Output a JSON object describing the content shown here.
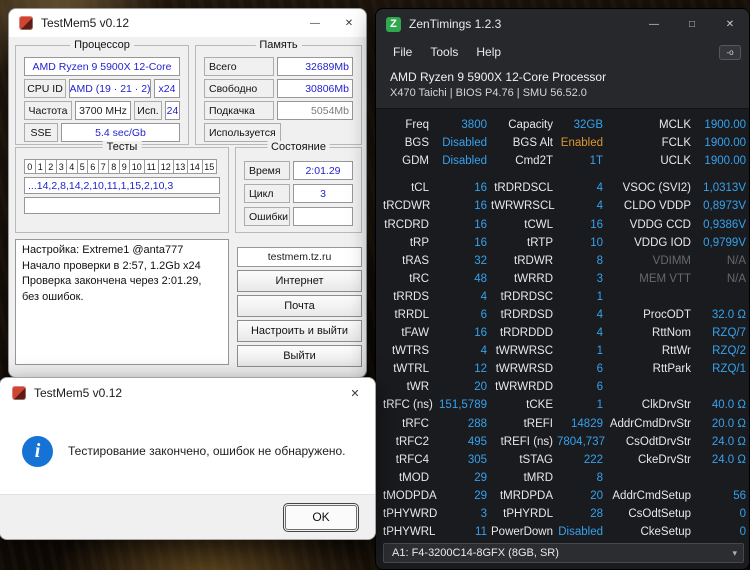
{
  "icons": {
    "minimize": "—",
    "maximize": "□",
    "close": "✕",
    "chevron_down": "▾",
    "info": "i",
    "logo_z": "Z",
    "report": "-o"
  },
  "tm5": {
    "title": "TestMem5 v0.12",
    "accent": "#1f1fd0",
    "cpu_group": {
      "title": "Процессор",
      "cpu_name": "AMD Ryzen 9 5900X 12-Core",
      "cpuid_label": "CPU ID",
      "cpuid_value": "AMD (19 · 21 · 2)",
      "cpuid_mult": "x24",
      "freq_label": "Частота",
      "freq_value": "3700 MHz",
      "used_label": "Исп.",
      "used_value": "24",
      "sse_label": "SSE",
      "sse_value": "5.4 sec/Gb"
    },
    "mem_group": {
      "title": "Память",
      "rows": [
        {
          "label": "Всего",
          "value": "32689Mb"
        },
        {
          "label": "Свободно",
          "value": "30806Mb"
        },
        {
          "label": "Подкачка",
          "value": "5054Mb"
        },
        {
          "label": "Используется",
          "value": ""
        }
      ]
    },
    "tests_group": {
      "title": "Тесты",
      "cells": [
        "0",
        "1",
        "2",
        "3",
        "4",
        "5",
        "6",
        "7",
        "8",
        "9",
        "10",
        "11",
        "12",
        "13",
        "14",
        "15"
      ],
      "sequence": "...14,2,8,14,2,10,11,1,15,2,10,3"
    },
    "state_group": {
      "title": "Состояние",
      "rows": [
        {
          "label": "Время",
          "value": "2:01.29"
        },
        {
          "label": "Цикл",
          "value": "3"
        },
        {
          "label": "Ошибки",
          "value": ""
        }
      ]
    },
    "log_lines": [
      "Настройка: Extreme1 @anta777",
      "Начало проверки в 2:57, 1.2Gb x24",
      "Проверка закончена через 2:01.29,",
      "без ошибок."
    ],
    "site": "testmem.tz.ru",
    "buttons": [
      "Интернет",
      "Почта",
      "Настроить и выйти",
      "Выйти"
    ]
  },
  "dialog": {
    "title": "TestMem5 v0.12",
    "message": "Тестирование закончено, ошибок не обнаружено.",
    "ok_label": "OK"
  },
  "zt": {
    "title": "ZenTimings 1.2.3",
    "menu": [
      "File",
      "Tools",
      "Help"
    ],
    "cpu_line1": "AMD Ryzen 9 5900X 12-Core Processor",
    "cpu_line2": "X470 Taichi | BIOS P4.76 | SMU 56.52.0",
    "colors": {
      "value": "#35a2ee",
      "enabled": "#dd962f",
      "na": "#66686c"
    },
    "rows": [
      {
        "l1": "Freq",
        "v1": "3800",
        "l2": "Capacity",
        "v2": "32GB",
        "l3": "MCLK",
        "v3": "1900.00"
      },
      {
        "l1": "BGS",
        "v1": "Disabled",
        "l2": "BGS Alt",
        "v2": "Enabled",
        "l3": "FCLK",
        "v3": "1900.00"
      },
      {
        "l1": "GDM",
        "v1": "Disabled",
        "l2": "Cmd2T",
        "v2": "1T",
        "l3": "UCLK",
        "v3": "1900.00"
      },
      {
        "l1": "tCL",
        "v1": "16",
        "l2": "tRDRDSCL",
        "v2": "4",
        "l3": "VSOC (SVI2)",
        "v3": "1,0313V"
      },
      {
        "l1": "tRCDWR",
        "v1": "16",
        "l2": "tWRWRSCL",
        "v2": "4",
        "l3": "CLDO VDDP",
        "v3": "0,8973V"
      },
      {
        "l1": "tRCDRD",
        "v1": "16",
        "l2": "tCWL",
        "v2": "16",
        "l3": "VDDG CCD",
        "v3": "0,9386V"
      },
      {
        "l1": "tRP",
        "v1": "16",
        "l2": "tRTP",
        "v2": "10",
        "l3": "VDDG IOD",
        "v3": "0,9799V"
      },
      {
        "l1": "tRAS",
        "v1": "32",
        "l2": "tRDWR",
        "v2": "8",
        "l3": "VDIMM",
        "v3": "N/A"
      },
      {
        "l1": "tRC",
        "v1": "48",
        "l2": "tWRRD",
        "v2": "3",
        "l3": "MEM VTT",
        "v3": "N/A"
      },
      {
        "l1": "tRRDS",
        "v1": "4",
        "l2": "tRDRDSC",
        "v2": "1",
        "l3": "",
        "v3": ""
      },
      {
        "l1": "tRRDL",
        "v1": "6",
        "l2": "tRDRDSD",
        "v2": "4",
        "l3": "ProcODT",
        "v3": "32.0 Ω"
      },
      {
        "l1": "tFAW",
        "v1": "16",
        "l2": "tRDRDDD",
        "v2": "4",
        "l3": "RttNom",
        "v3": "RZQ/7"
      },
      {
        "l1": "tWTRS",
        "v1": "4",
        "l2": "tWRWRSC",
        "v2": "1",
        "l3": "RttWr",
        "v3": "RZQ/2"
      },
      {
        "l1": "tWTRL",
        "v1": "12",
        "l2": "tWRWRSD",
        "v2": "6",
        "l3": "RttPark",
        "v3": "RZQ/1"
      },
      {
        "l1": "tWR",
        "v1": "20",
        "l2": "tWRWRDD",
        "v2": "6",
        "l3": "",
        "v3": ""
      },
      {
        "l1": "tRFC (ns)",
        "v1": "151,5789",
        "l2": "tCKE",
        "v2": "1",
        "l3": "ClkDrvStr",
        "v3": "40.0 Ω"
      },
      {
        "l1": "tRFC",
        "v1": "288",
        "l2": "tREFI",
        "v2": "14829",
        "l3": "AddrCmdDrvStr",
        "v3": "20.0 Ω"
      },
      {
        "l1": "tRFC2",
        "v1": "495",
        "l2": "tREFI (ns)",
        "v2": "7804,737",
        "l3": "CsOdtDrvStr",
        "v3": "24.0 Ω"
      },
      {
        "l1": "tRFC4",
        "v1": "305",
        "l2": "tSTAG",
        "v2": "222",
        "l3": "CkeDrvStr",
        "v3": "24.0 Ω"
      },
      {
        "l1": "tMOD",
        "v1": "29",
        "l2": "tMRD",
        "v2": "8",
        "l3": "",
        "v3": ""
      },
      {
        "l1": "tMODPDA",
        "v1": "29",
        "l2": "tMRDPDA",
        "v2": "20",
        "l3": "AddrCmdSetup",
        "v3": "56"
      },
      {
        "l1": "tPHYWRD",
        "v1": "3",
        "l2": "tPHYRDL",
        "v2": "28",
        "l3": "CsOdtSetup",
        "v3": "0"
      },
      {
        "l1": "tPHYWRL",
        "v1": "11",
        "l2": "PowerDown",
        "v2": "Disabled",
        "l3": "CkeSetup",
        "v3": "0"
      }
    ],
    "dimm_select": "A1: F4-3200C14-8GFX (8GB, SR)"
  }
}
